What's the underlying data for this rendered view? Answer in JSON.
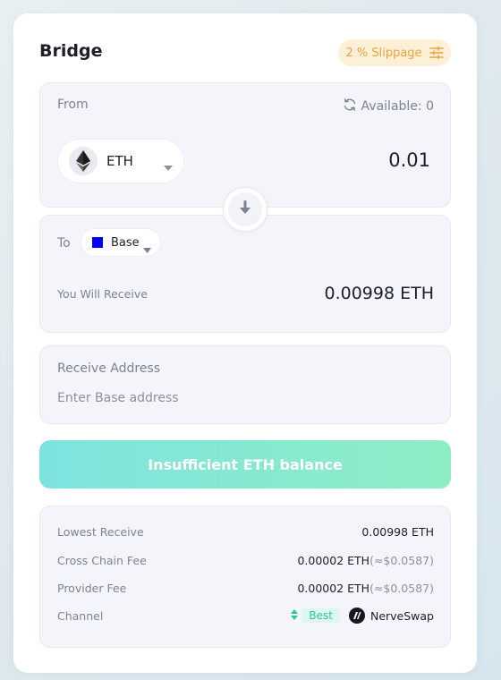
{
  "header": {
    "title": "Bridge",
    "slippage_label": "2 % Slippage"
  },
  "from": {
    "label": "From",
    "available_label": "Available: 0",
    "token": "ETH",
    "amount": "0.01"
  },
  "to": {
    "label": "To",
    "chain": "Base",
    "receive_label": "You Will Receive",
    "receive_value": "0.00998 ETH"
  },
  "address": {
    "label": "Receive Address",
    "placeholder": "Enter Base address",
    "value": ""
  },
  "submit": {
    "label": "Insufficient ETH balance"
  },
  "info": {
    "lowest_receive_label": "Lowest Receive",
    "lowest_receive_value": "0.00998 ETH",
    "cross_chain_fee_label": "Cross Chain Fee",
    "cross_chain_fee_value": "0.00002 ETH",
    "cross_chain_fee_usd": "(≈$0.0587)",
    "provider_fee_label": "Provider Fee",
    "provider_fee_value": "0.00002 ETH",
    "provider_fee_usd": "(≈$0.0587)",
    "channel_label": "Channel",
    "channel_badge": "Best",
    "channel_name": "NerveSwap"
  },
  "icons": {
    "slippage": "sliders-icon",
    "refresh": "refresh-icon",
    "token": "eth-icon",
    "swap": "arrow-down-icon",
    "chain": "base-chain-icon",
    "provider": "nerveswap-logo"
  },
  "colors": {
    "accent_orange": "#eea33a",
    "button_gradient_start": "#7ee3df",
    "button_gradient_end": "#8fedc4",
    "best_green": "#2ec59a",
    "base_blue": "#0000ff"
  }
}
